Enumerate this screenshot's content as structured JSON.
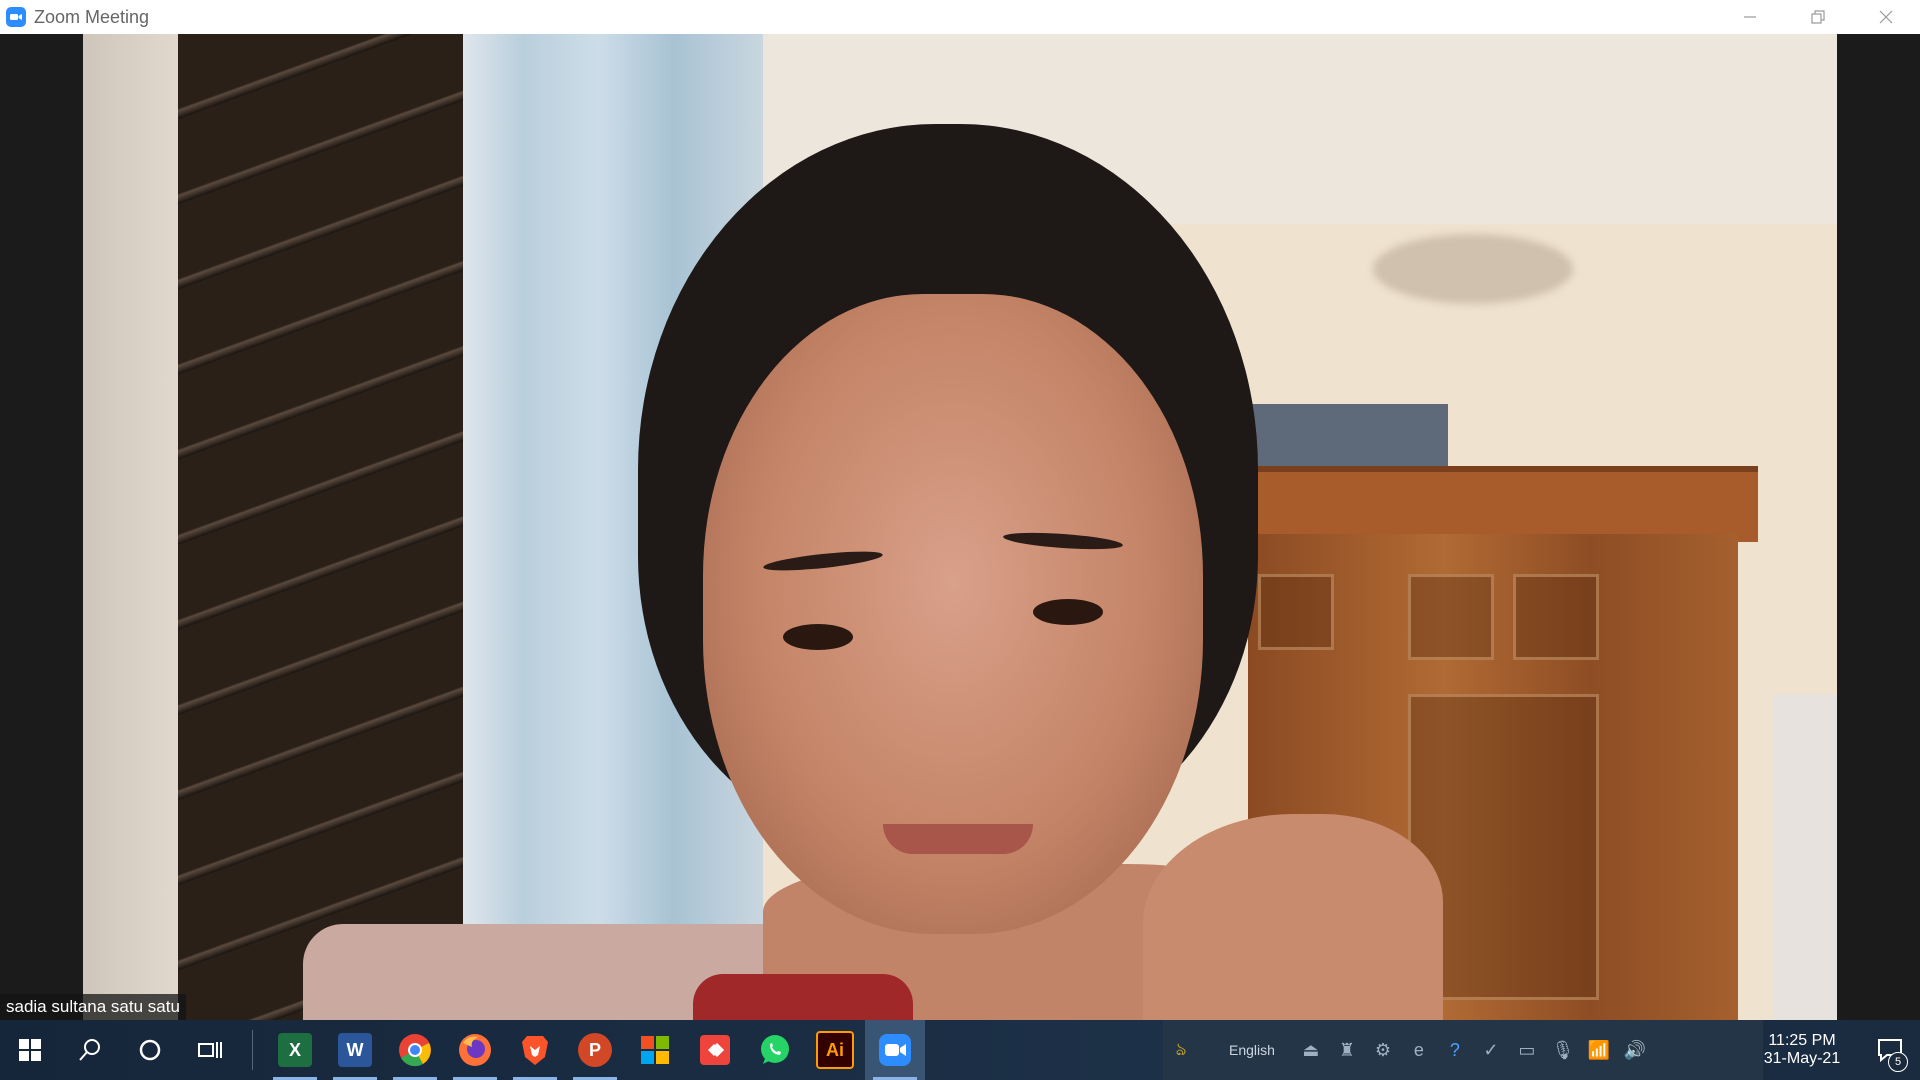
{
  "window": {
    "title": "Zoom Meeting",
    "accent": "#2D8CFF"
  },
  "meeting": {
    "participant_name": "sadia sultana satu satu"
  },
  "taskbar": {
    "apps": [
      {
        "name": "Excel",
        "glyph": "X",
        "color": "#1D6F42"
      },
      {
        "name": "Word",
        "glyph": "W",
        "color": "#2B579A"
      },
      {
        "name": "Chrome",
        "glyph": "",
        "color": "#EA4335"
      },
      {
        "name": "Firefox",
        "glyph": "",
        "color": "#FF7139"
      },
      {
        "name": "Brave",
        "glyph": "",
        "color": "#FB542B"
      },
      {
        "name": "PowerPoint",
        "glyph": "P",
        "color": "#D24726"
      },
      {
        "name": "Microsoft Store",
        "glyph": "",
        "color": "#F25022"
      },
      {
        "name": "AnyDesk",
        "glyph": "",
        "color": "#EF443B"
      },
      {
        "name": "WhatsApp",
        "glyph": "",
        "color": "#25D366"
      },
      {
        "name": "Illustrator",
        "glyph": "Ai",
        "color": "#FF9A00"
      },
      {
        "name": "Zoom",
        "glyph": "",
        "color": "#2D8CFF"
      }
    ],
    "language": "English",
    "time": "11:25 PM",
    "date": "31-May-21",
    "notification_count": "5"
  }
}
